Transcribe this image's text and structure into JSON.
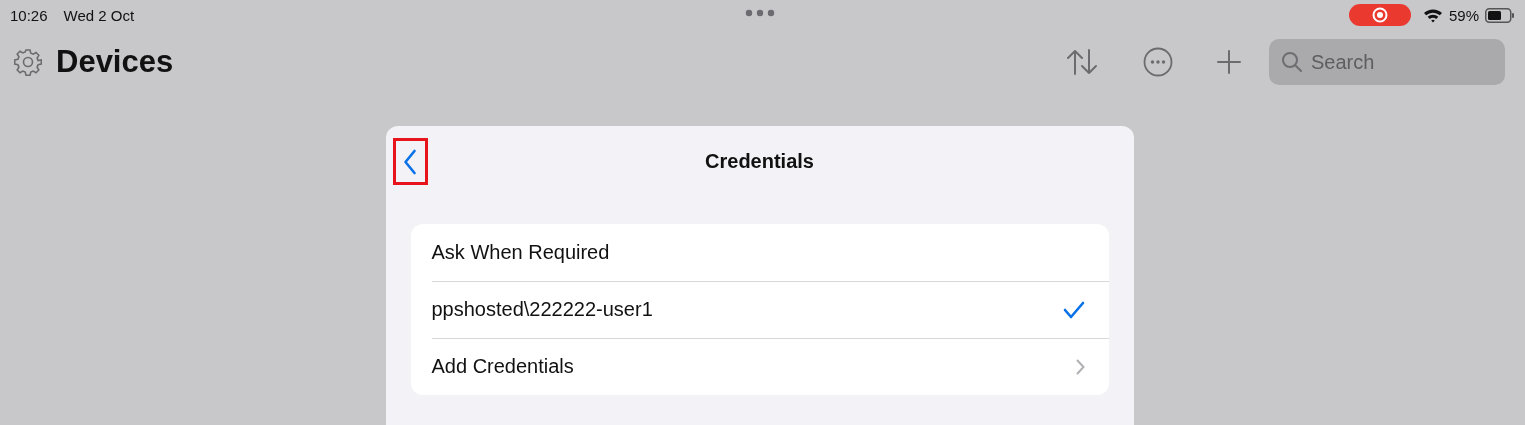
{
  "status_bar": {
    "time": "10:26",
    "date": "Wed 2 Oct",
    "battery": "59%"
  },
  "nav": {
    "title": "Devices",
    "search": {
      "placeholder": "Search"
    }
  },
  "sheet": {
    "title": "Credentials",
    "back_button": {
      "highlighted": true
    },
    "rows": [
      {
        "label": "Ask When Required",
        "kind": "option",
        "selected": false
      },
      {
        "label": "ppshosted\\222222-user1",
        "kind": "option",
        "selected": true
      },
      {
        "label": "Add Credentials",
        "kind": "link"
      }
    ]
  }
}
